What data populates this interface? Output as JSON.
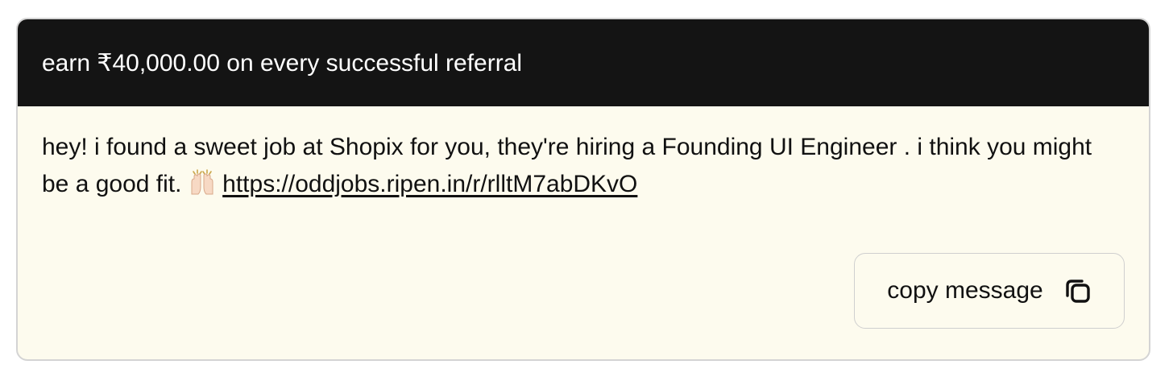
{
  "header": {
    "title": "earn ₹40,000.00 on every successful referral"
  },
  "message": {
    "text_before_link": "hey! i found a sweet job at Shopix for you, they're hiring a Founding UI Engineer . i think you might be a good fit. ",
    "emoji": "🙌🏻",
    "emoji_icon": "raising-hands-icon",
    "link": "https://oddjobs.ripen.in/r/rlltM7abDKvO"
  },
  "actions": {
    "copy_label": "copy message",
    "copy_icon": "copy-icon"
  },
  "colors": {
    "header_bg": "#141414",
    "body_bg": "#fdfbee",
    "border": "#d4d4d4"
  }
}
